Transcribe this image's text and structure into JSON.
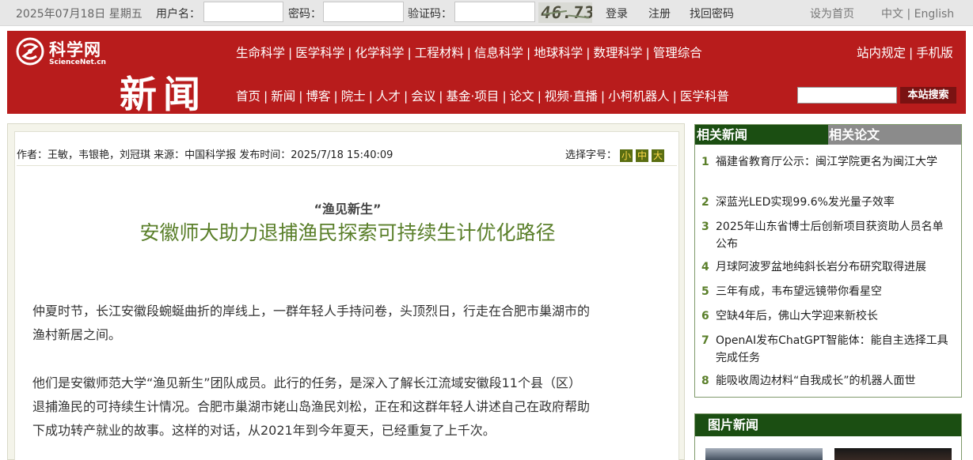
{
  "topbar": {
    "date": "2025年07月18日 星期五",
    "username_label": "用户名：",
    "username_value": "",
    "password_label": "密码：",
    "password_value": "",
    "captcha_label": "验证码：",
    "captcha_value": "",
    "captcha_text": "46.73",
    "login": "登录",
    "register": "注册",
    "forgot": "找回密码",
    "set_home": "设为首页",
    "lang": "中文 | English"
  },
  "header": {
    "logo_cn": "科学网",
    "logo_en": "ScienceNet.cn",
    "section_title": "新闻",
    "nav_top": [
      "生命科学",
      "医学科学",
      "化学科学",
      "工程材料",
      "信息科学",
      "地球科学",
      "数理科学",
      "管理综合"
    ],
    "nav_right": [
      "站内规定",
      "手机版"
    ],
    "nav_bottom": [
      "首页",
      "新闻",
      "博客",
      "院士",
      "人才",
      "会议",
      "基金·项目",
      "论文",
      "视频·直播",
      "小柯机器人",
      "医学科普"
    ],
    "search_value": "",
    "search_button": "本站搜索"
  },
  "article": {
    "meta": "作者：王敏，韦银艳，刘冠琪 来源：中国科学报 发布时间：2025/7/18 15:40:09",
    "font_select_label": "选择字号：",
    "font_sizes": [
      "小",
      "中",
      "大"
    ],
    "subtitle": "“渔见新生”",
    "title": "安徽师大助力退捕渔民探索可持续生计优化路径",
    "paragraphs": [
      [
        "仲夏时节，长江安徽段蜿蜒曲折的岸线上，一群年轻人手持问卷，头顶烈日，行走在合肥市巢湖市的",
        "渔村新居之间。"
      ],
      [
        "他们是安徽师范大学“渔见新生”团队成员。此行的任务，是深入了解长江流域安徽段11个县（区）",
        "退捕渔民的可持续生计情况。合肥市巢湖市姥山岛渔民刘松，正在和这群年轻人讲述自己在政府帮助",
        "下成功转产就业的故事。这样的对话，从2021年到今年夏天，已经重复了上千次。"
      ]
    ]
  },
  "related": {
    "tab_news": "相关新闻",
    "tab_papers": "相关论文",
    "items": [
      {
        "n": "1",
        "text": "福建省教育厅公示：闽江学院更名为闽江大学"
      },
      {
        "n": "2",
        "text": "深蓝光LED实现99.6%发光量子效率"
      },
      {
        "n": "3",
        "text": "2025年山东省博士后创新项目获资助人员名单公布"
      },
      {
        "n": "4",
        "text": "月球阿波罗盆地纯斜长岩分布研究取得进展"
      },
      {
        "n": "5",
        "text": "三年有成，韦布望远镜带你看星空"
      },
      {
        "n": "6",
        "text": "空缺4年后，佛山大学迎来新校长"
      },
      {
        "n": "7",
        "text": "OpenAI发布ChatGPT智能体：能自主选择工具完成任务"
      },
      {
        "n": "8",
        "text": "能吸收周边材料“自我成长”的机器人面世"
      }
    ]
  },
  "photo_news": {
    "title": "图片新闻"
  },
  "colors": {
    "header_red": "#b81c1c",
    "tab_green": "#1b4e12",
    "headline_green": "#5a7f2a"
  }
}
